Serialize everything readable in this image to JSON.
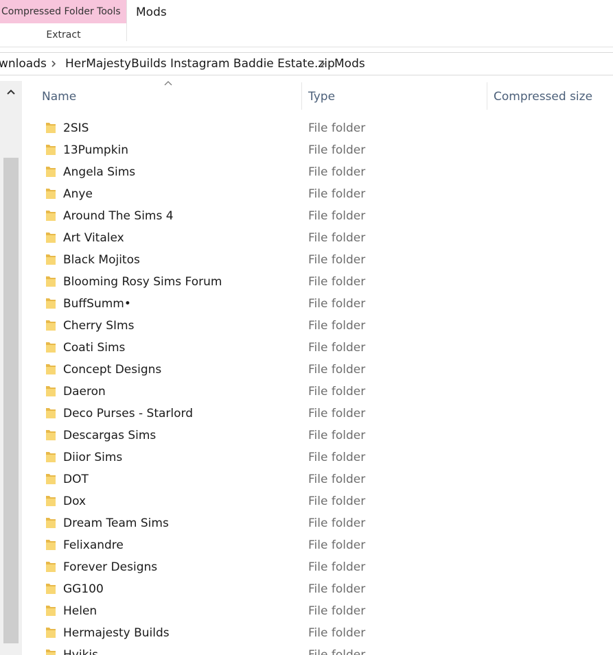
{
  "ribbon": {
    "context_group_title": "Compressed Folder Tools",
    "context_tab": "Extract",
    "window_title": "Mods"
  },
  "address": {
    "crumbs": [
      "wnloads",
      "HerMajestyBuilds Instagram Baddie Estate.zip",
      "Mods"
    ]
  },
  "columns": {
    "name": "Name",
    "type": "Type",
    "compressed_size": "Compressed size"
  },
  "colors": {
    "context_tab_bg": "#f7c5dc",
    "folder": "#f8d775",
    "header_text": "#4c607a"
  },
  "files": [
    {
      "name": "2SIS",
      "type": "File folder",
      "compressed_size": ""
    },
    {
      "name": "13Pumpkin",
      "type": "File folder",
      "compressed_size": ""
    },
    {
      "name": "Angela Sims",
      "type": "File folder",
      "compressed_size": ""
    },
    {
      "name": "Anye",
      "type": "File folder",
      "compressed_size": ""
    },
    {
      "name": "Around The Sims 4",
      "type": "File folder",
      "compressed_size": ""
    },
    {
      "name": "Art Vitalex",
      "type": "File folder",
      "compressed_size": ""
    },
    {
      "name": "Black Mojitos",
      "type": "File folder",
      "compressed_size": ""
    },
    {
      "name": "Blooming Rosy Sims Forum",
      "type": "File folder",
      "compressed_size": ""
    },
    {
      "name": "BuffSumm•",
      "type": "File folder",
      "compressed_size": ""
    },
    {
      "name": "Cherry SIms",
      "type": "File folder",
      "compressed_size": ""
    },
    {
      "name": "Coati Sims",
      "type": "File folder",
      "compressed_size": ""
    },
    {
      "name": "Concept Designs",
      "type": "File folder",
      "compressed_size": ""
    },
    {
      "name": "Daeron",
      "type": "File folder",
      "compressed_size": ""
    },
    {
      "name": "Deco Purses - Starlord",
      "type": "File folder",
      "compressed_size": ""
    },
    {
      "name": "Descargas Sims",
      "type": "File folder",
      "compressed_size": ""
    },
    {
      "name": "Diior Sims",
      "type": "File folder",
      "compressed_size": ""
    },
    {
      "name": "DOT",
      "type": "File folder",
      "compressed_size": ""
    },
    {
      "name": "Dox",
      "type": "File folder",
      "compressed_size": ""
    },
    {
      "name": "Dream Team Sims",
      "type": "File folder",
      "compressed_size": ""
    },
    {
      "name": "Felixandre",
      "type": "File folder",
      "compressed_size": ""
    },
    {
      "name": "Forever Designs",
      "type": "File folder",
      "compressed_size": ""
    },
    {
      "name": "GG100",
      "type": "File folder",
      "compressed_size": ""
    },
    {
      "name": "Helen",
      "type": "File folder",
      "compressed_size": ""
    },
    {
      "name": "Hermajesty Builds",
      "type": "File folder",
      "compressed_size": ""
    },
    {
      "name": "Hvikis",
      "type": "File folder",
      "compressed_size": ""
    }
  ]
}
